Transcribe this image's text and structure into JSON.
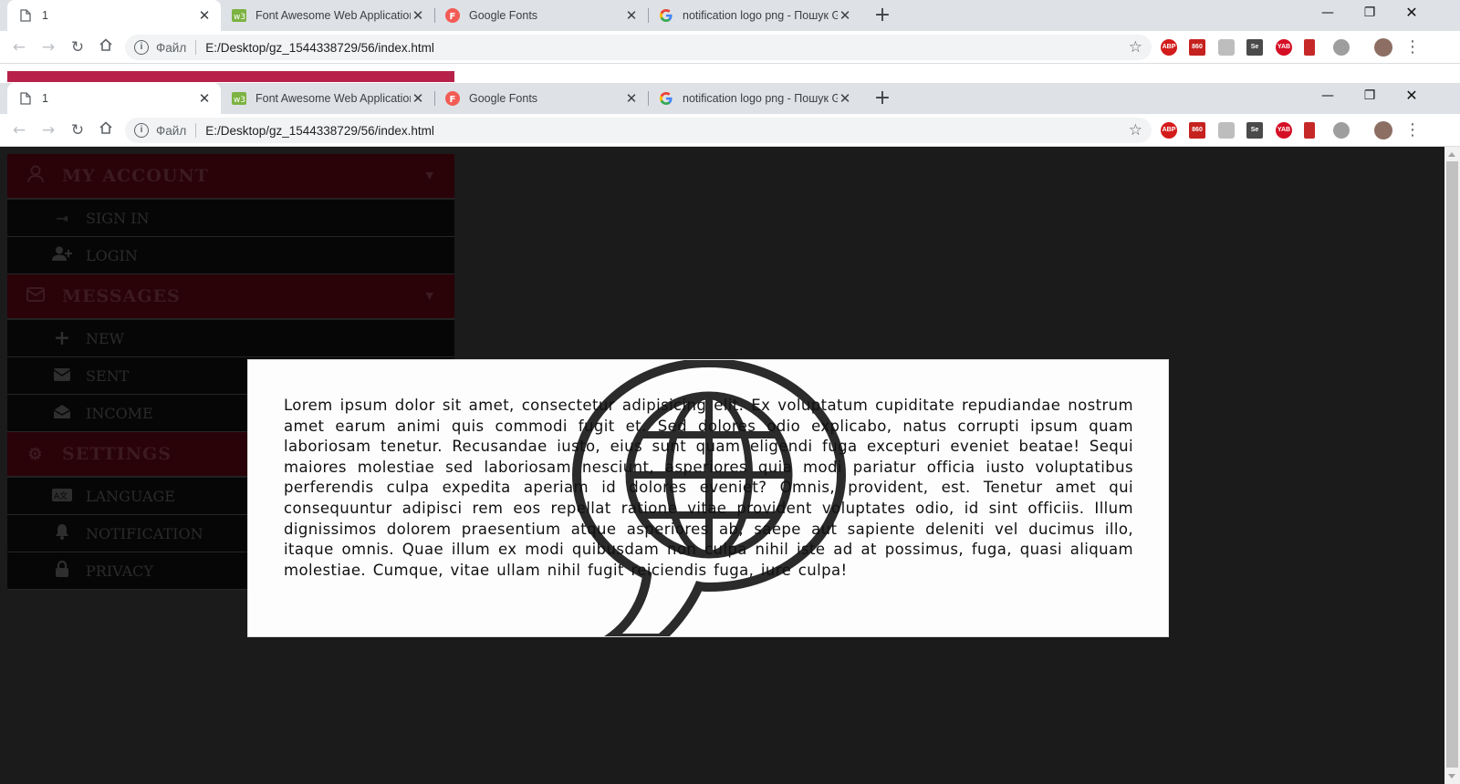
{
  "browser": {
    "tabs": [
      {
        "title": "1",
        "icon": "page-icon",
        "active": true
      },
      {
        "title": "Font Awesome Web Application Icons",
        "icon": "fontawesome-favicon",
        "active": false
      },
      {
        "title": "Google Fonts",
        "icon": "googlefonts-favicon",
        "active": false
      },
      {
        "title": "notification logo png - Пошук Google",
        "icon": "google-favicon",
        "active": false
      }
    ],
    "address": {
      "file_label": "Файл",
      "url": "E:/Desktop/gz_1544338729/56/index.html"
    },
    "extensions": [
      {
        "name": "adblock-plus-icon",
        "label": "ABP",
        "color": "#d41b1b"
      },
      {
        "name": "gmail-counter-icon",
        "label": "860",
        "color": "#c5221f"
      },
      {
        "name": "camera-extension-icon",
        "label": "",
        "color": "#bdbdbd"
      },
      {
        "name": "selenium-icon",
        "label": "Se",
        "color": "#4a4a4a"
      },
      {
        "name": "yab-icon",
        "label": "YAB",
        "color": "#d50f25"
      },
      {
        "name": "bookmark-extension-icon",
        "label": "",
        "color": "#c62828"
      },
      {
        "name": "cloud-extension-icon",
        "label": "",
        "color": "#9e9e9e"
      }
    ]
  },
  "sidebar": {
    "sections": [
      {
        "heading": "MY ACCOUNT",
        "icon": "user-icon",
        "items": [
          {
            "label": "SIGN IN",
            "icon": "sign-in-icon"
          },
          {
            "label": "LOGIN",
            "icon": "user-plus-icon"
          }
        ]
      },
      {
        "heading": "MESSAGES",
        "icon": "envelope-icon",
        "items": [
          {
            "label": "NEW",
            "icon": "plus-icon"
          },
          {
            "label": "SENT",
            "icon": "envelope-closed-icon"
          },
          {
            "label": "INCOME",
            "icon": "envelope-open-icon"
          }
        ]
      },
      {
        "heading": "SETTINGS",
        "icon": "gear-icon",
        "items": [
          {
            "label": "LANGUAGE",
            "icon": "language-icon"
          },
          {
            "label": "NOTIFICATION",
            "icon": "bell-icon"
          },
          {
            "label": "PRIVACY",
            "icon": "lock-icon"
          }
        ]
      }
    ]
  },
  "modal": {
    "icon": "globe-speech-bubble-icon",
    "text": "Lorem ipsum dolor sit amet, consectetur adipisicing elit. Ex voluptatum cupiditate repudiandae nostrum amet earum animi quis commodi fugit et. Sed dolores odio explicabo, natus corrupti ipsum quam laboriosam tenetur. Recusandae iusto, eius sunt quam eligendi fuga excepturi eveniet beatae! Sequi maiores molestiae sed laboriosam nesciunt, asperiores quia modi pariatur officia iusto voluptatibus perferendis culpa expedita aperiam id dolores eveniet? Omnis, provident, est. Tenetur amet qui consequuntur adipisci rem eos repellat ratione vitae provident voluptates odio, id sint officiis. Illum dignissimos dolorem praesentium atque asperiores ab, saepe aut sapiente deleniti vel ducimus illo, itaque omnis. Quae illum ex modi quibusdam non culpa nihil iste ad at possimus, fuga, quasi aliquam molestiae. Cumque, vitae ullam nihil fugit reiciendis fuga, iure culpa!"
  },
  "colors": {
    "accent": "#b7214a",
    "page_bg": "#1b1b1b",
    "heading_bg": "#2a0309",
    "item_bg": "#060606"
  }
}
